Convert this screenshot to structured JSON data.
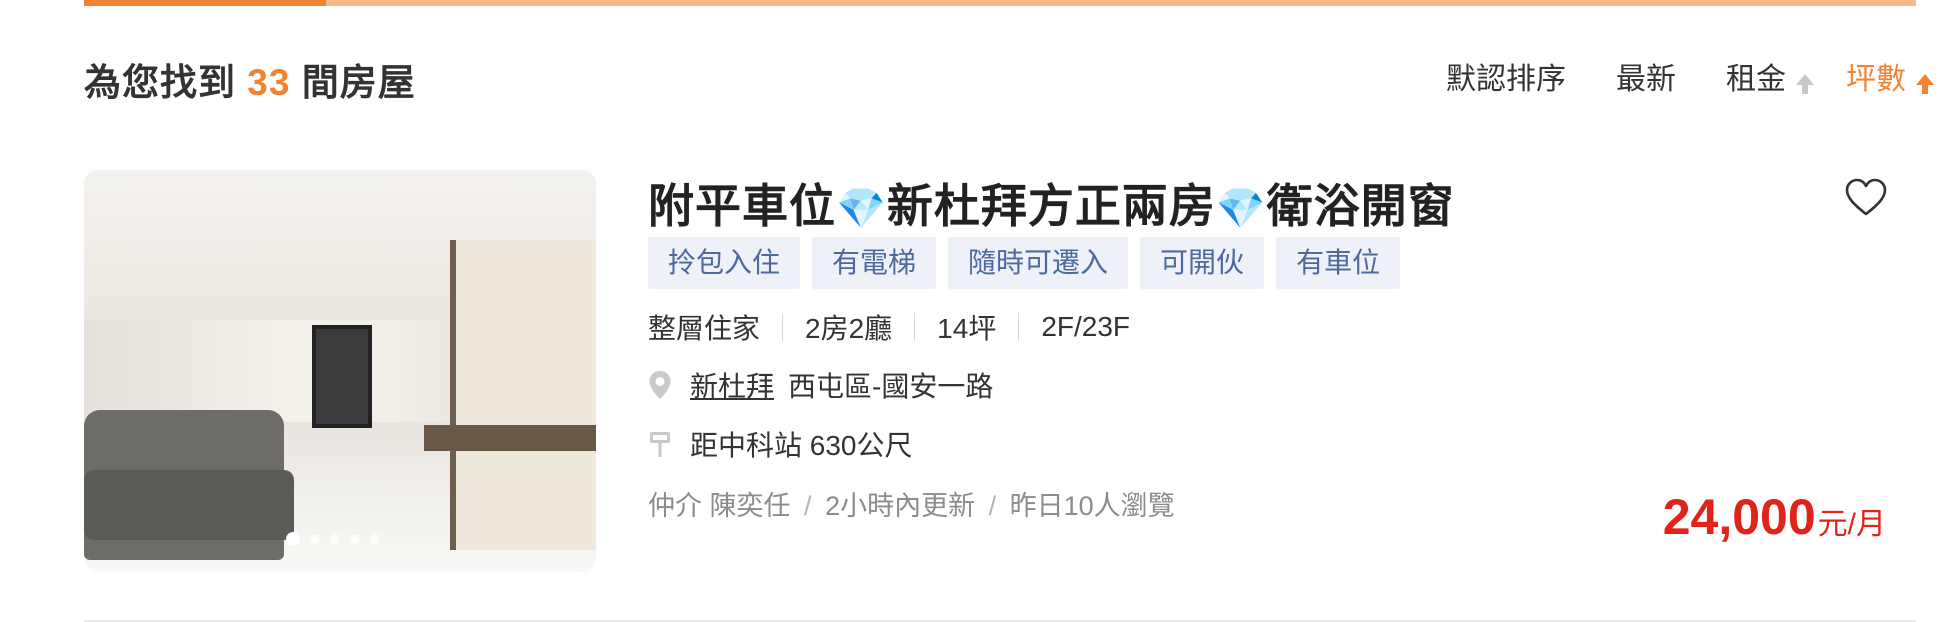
{
  "tabs_bar": {
    "active_color": "#f08432"
  },
  "result": {
    "prefix": "為您找到",
    "count": "33",
    "suffix": "間房屋"
  },
  "sort": {
    "items": [
      {
        "label": "默認排序",
        "active": false
      },
      {
        "label": "最新",
        "active": false
      },
      {
        "label": "租金",
        "active": false,
        "icon": "arrow-up-icon"
      },
      {
        "label": "坪數",
        "active": true,
        "icon": "arrow-up-icon"
      }
    ],
    "active_color": "#f08432"
  },
  "listing": {
    "photo": {
      "slides": 5,
      "current": 1
    },
    "title_parts": [
      "附平車位",
      "💎",
      "新杜拜方正兩房",
      "💎",
      "衛浴開窗"
    ],
    "favorite_icon": "heart-icon",
    "tags": [
      "拎包入住",
      "有電梯",
      "隨時可遷入",
      "可開伙",
      "有車位"
    ],
    "attributes": [
      "整層住家",
      "2房2廳",
      "14坪",
      "2F/23F"
    ],
    "location": {
      "icon": "location-pin-icon",
      "community": "新杜拜",
      "address": "西屯區-國安一路"
    },
    "transit": {
      "icon": "bus-stop-icon",
      "text": "距中科站 630公尺"
    },
    "meta": {
      "agent_role": "仲介",
      "agent_name": "陳奕任",
      "sep": "/",
      "updated": "2小時內更新",
      "views": "昨日10人瀏覽"
    },
    "price": {
      "value": "24,000",
      "unit": "元/月",
      "color": "#e2231a"
    }
  }
}
